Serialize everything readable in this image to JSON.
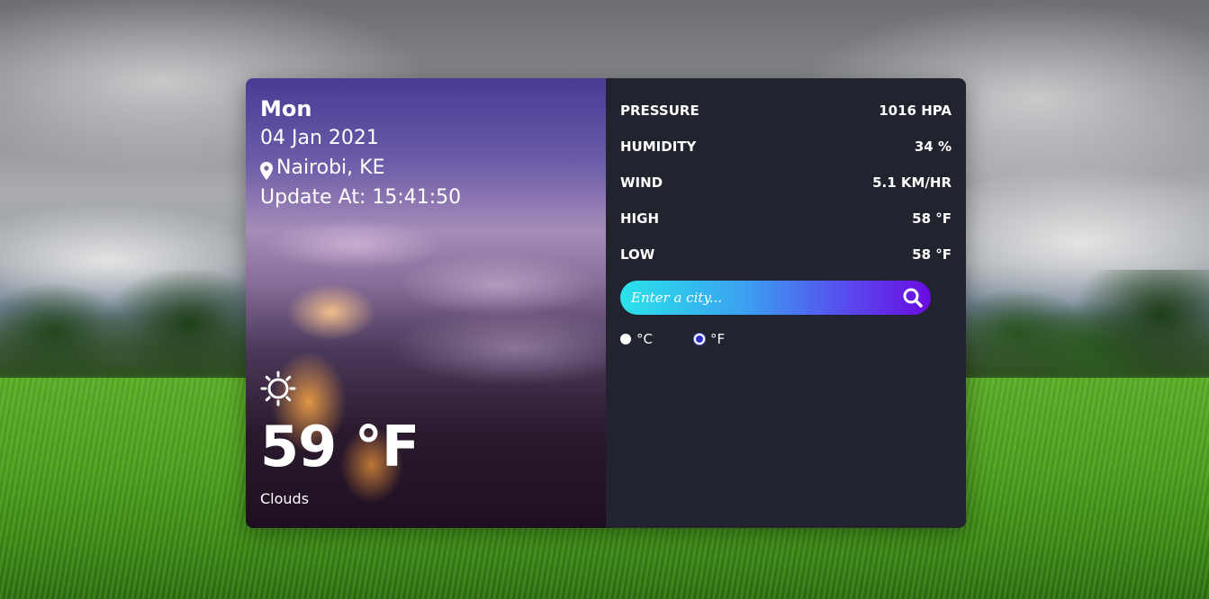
{
  "weather": {
    "day": "Mon",
    "date": "04 Jan 2021",
    "location": "Nairobi, KE",
    "updated": "Update At: 15:41:50",
    "temperature": "59 °F",
    "description": "Clouds",
    "condition_icon": "sun-icon"
  },
  "details": [
    {
      "label": "PRESSURE",
      "value": "1016 HPA"
    },
    {
      "label": "HUMIDITY",
      "value": "34 %"
    },
    {
      "label": "WIND",
      "value": "5.1 KM/HR"
    },
    {
      "label": "HIGH",
      "value": "58 °F"
    },
    {
      "label": "LOW",
      "value": "58 °F"
    }
  ],
  "search": {
    "placeholder": "Enter a city..."
  },
  "units": {
    "celsius": "°C",
    "fahrenheit": "°F",
    "selected": "°F"
  },
  "colors": {
    "panel": "#21232e",
    "search_gradient_start": "#2ae3ea",
    "search_gradient_end": "#6a0ce0",
    "radio_selected": "#2d2fc9"
  }
}
